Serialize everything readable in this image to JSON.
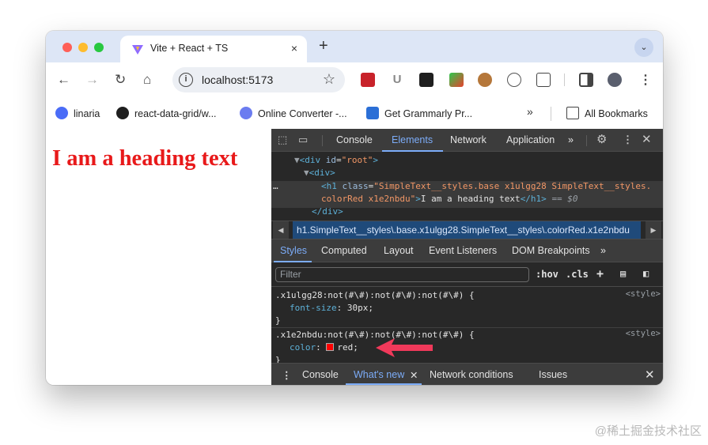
{
  "browser": {
    "tab": {
      "title": "Vite + React + TS",
      "close": "×"
    },
    "new_tab": "+",
    "tab_menu": "⌄",
    "url": "localhost:5173",
    "nav": {
      "back": "←",
      "forward": "→",
      "reload": "↻",
      "home": "⌂"
    },
    "bookmarks": [
      {
        "label": "linaria",
        "icon": "linaria-icon",
        "color": "#4a6cf7"
      },
      {
        "label": "react-data-grid/w...",
        "icon": "github-icon",
        "color": "#1f1f1f"
      },
      {
        "label": "Online Converter -...",
        "icon": "converter-icon",
        "color": "#6b7cf0"
      },
      {
        "label": "Get Grammarly Pr...",
        "icon": "grammarly-icon",
        "color": "#2b6fd6"
      }
    ],
    "bookmarks_more": "»",
    "all_bookmarks": "All Bookmarks"
  },
  "page": {
    "heading": "I am a heading text",
    "heading_color": "#e8191a"
  },
  "devtools": {
    "tabs": [
      "Console",
      "Elements",
      "Network",
      "Application"
    ],
    "active_tab": "Elements",
    "more_tabs": "»",
    "dom": {
      "line1_tag_open": "<div",
      "line1_attr": "id",
      "line1_val": "\"root\"",
      "line1_close": ">",
      "line2": "<div>",
      "line3_tag": "<h1",
      "line3_attr": "class",
      "line3_val": "\"SimpleText__styles.base x1ulgg28 SimpleText__styles.",
      "line4_val": "colorRed x1e2nbdu\"",
      "line4_close": ">",
      "line4_text": "I am a heading text",
      "line4_endtag": "</h1>",
      "line4_eq": "== $0",
      "line5": "</div>",
      "ellipsis": "…"
    },
    "breadcrumb": "h1.SimpleText__styles\\.base.x1ulgg28.SimpleText__styles\\.colorRed.x1e2nbdu",
    "subtabs": [
      "Styles",
      "Computed",
      "Layout",
      "Event Listeners",
      "DOM Breakpoints"
    ],
    "active_subtab": "Styles",
    "subtabs_more": "»",
    "filter_placeholder": "Filter",
    "hov": ":hov",
    "cls": ".cls",
    "rules": [
      {
        "selector": ".x1ulgg28:not(#\\#):not(#\\#):not(#\\#) {",
        "prop": "font-size",
        "value": "30px;",
        "source": "<style>",
        "close": "}"
      },
      {
        "selector": ".x1e2nbdu:not(#\\#):not(#\\#):not(#\\#) {",
        "prop": "color",
        "value": "red;",
        "source": "<style>",
        "close": "}"
      }
    ],
    "drawer_tabs": [
      "Console",
      "What's new",
      "Network conditions",
      "Issues"
    ],
    "active_drawer": "What's new",
    "arrow_color": "#f0395a"
  },
  "watermark": "@稀土掘金技术社区"
}
